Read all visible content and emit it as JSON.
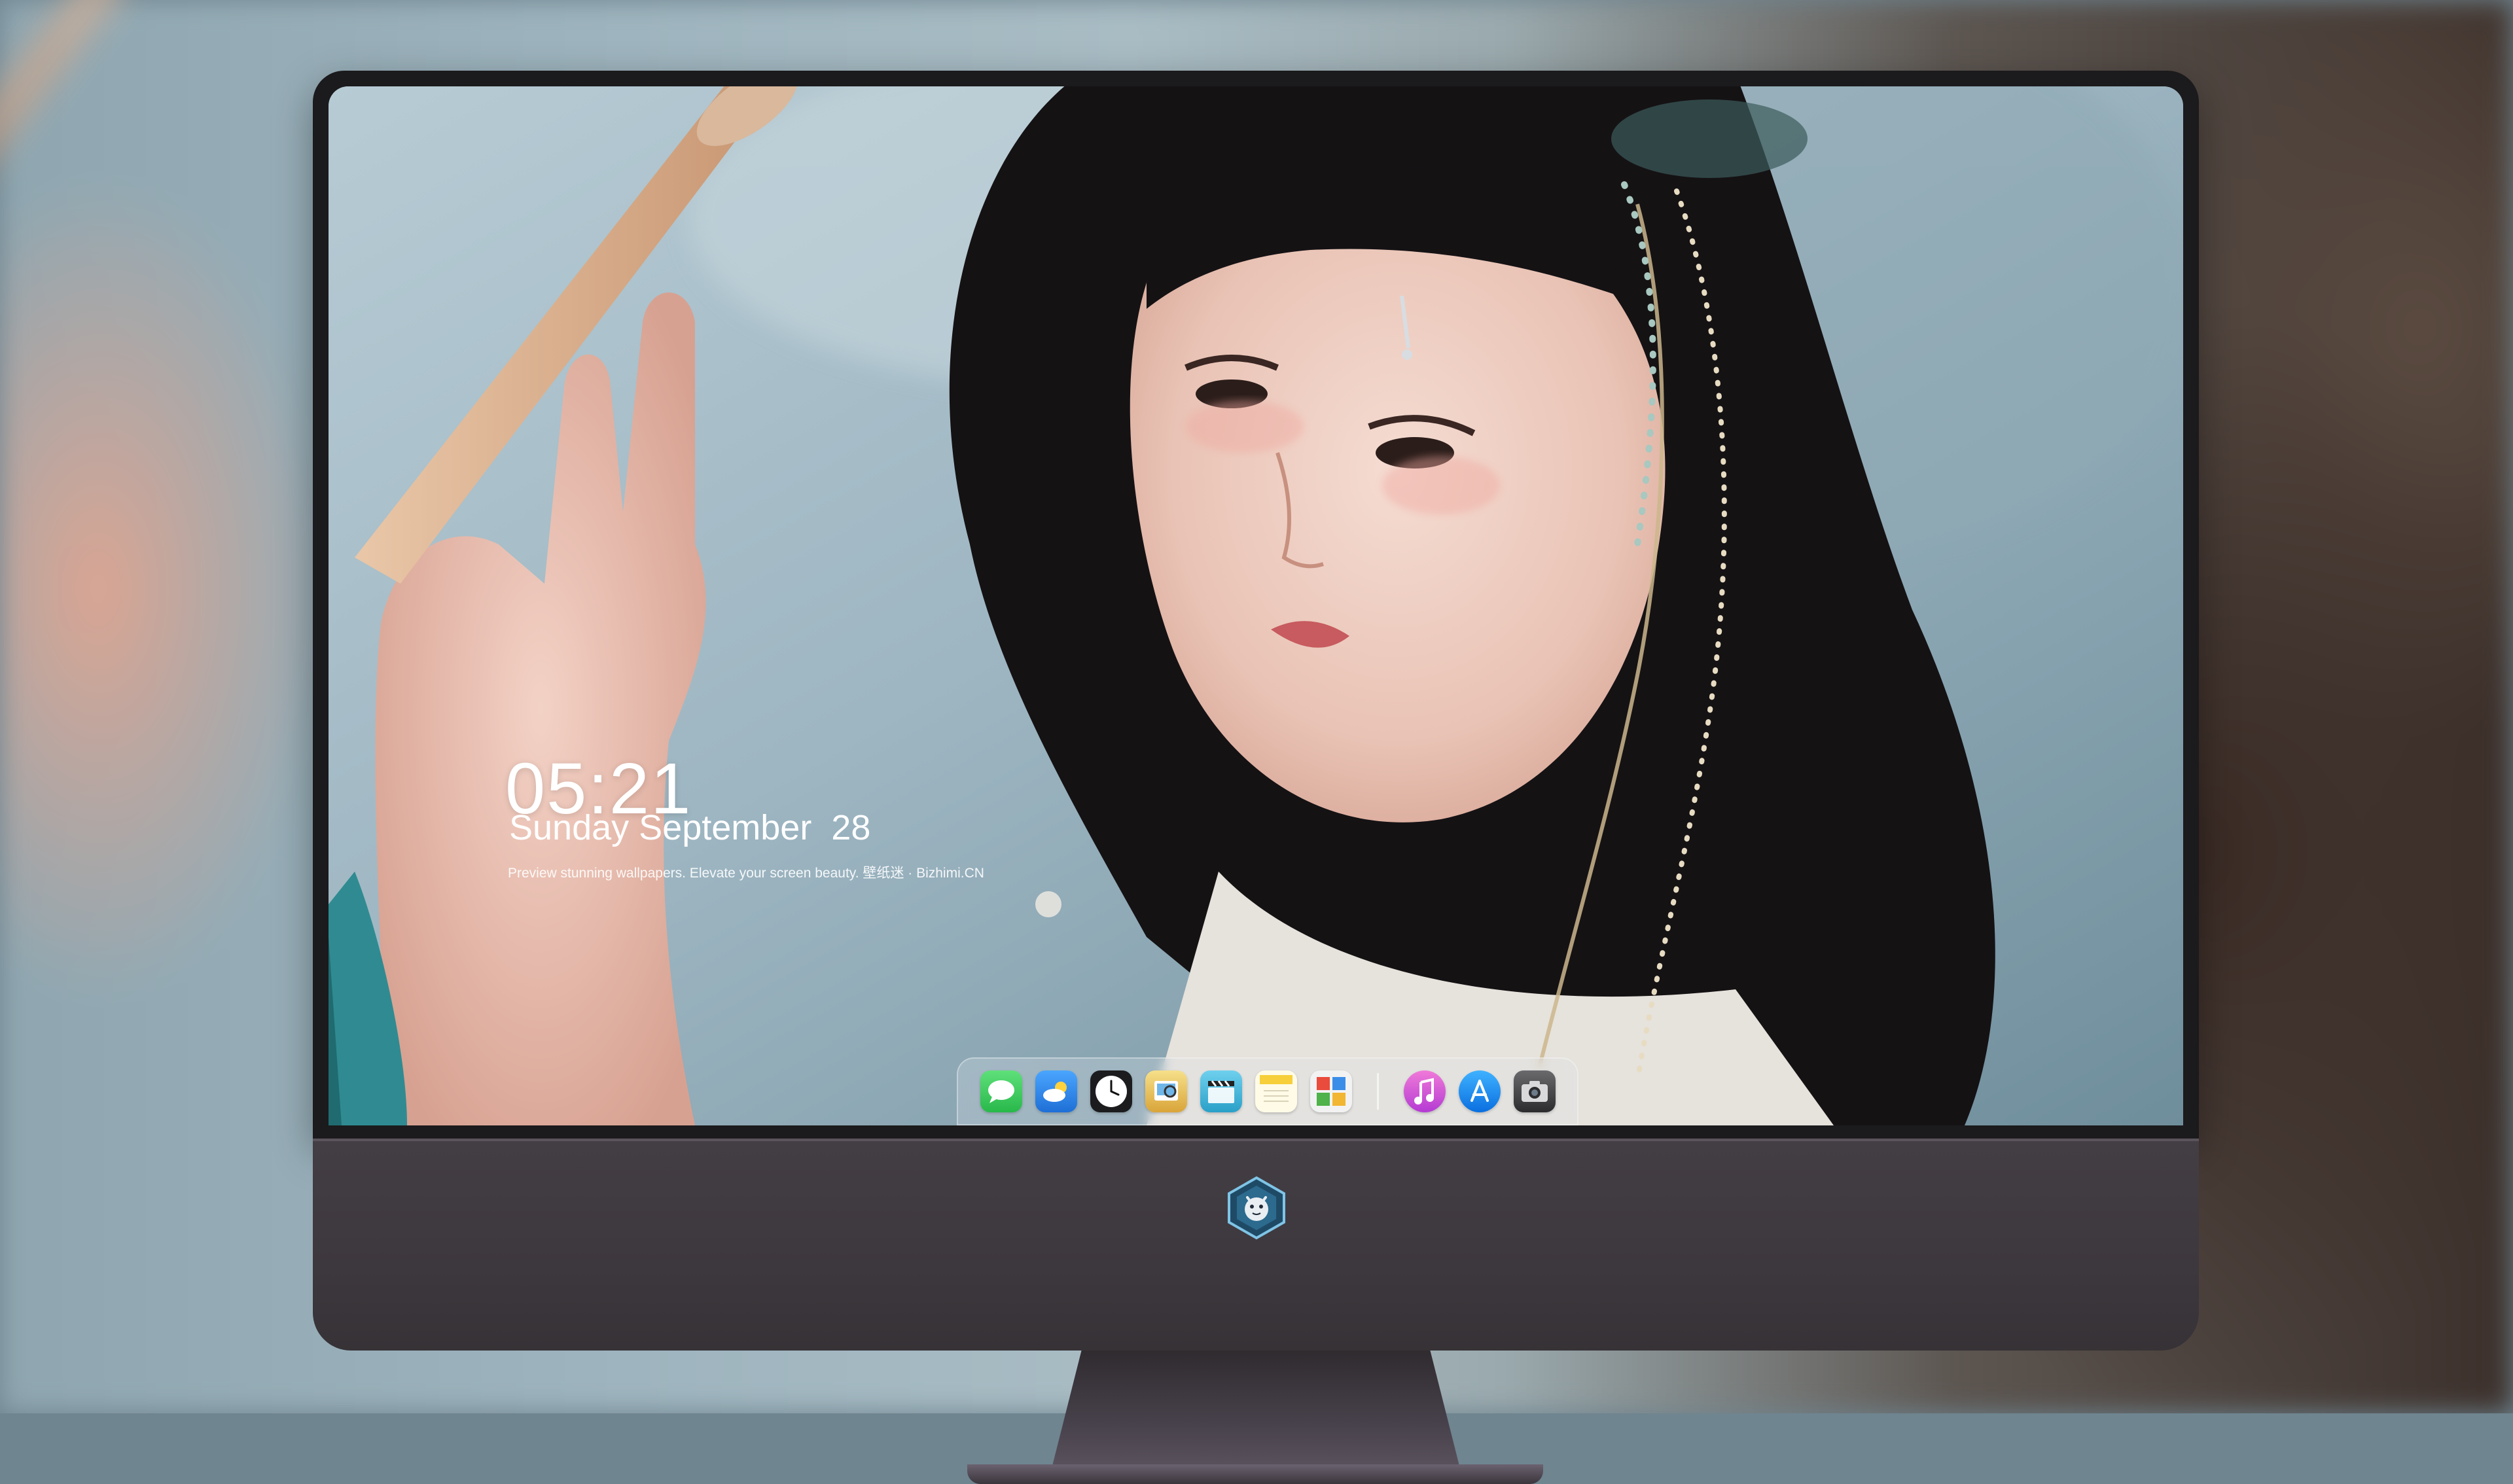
{
  "lockscreen": {
    "time": "05:21",
    "date": "Sunday September  28",
    "caption": "Preview stunning wallpapers. Elevate your screen beauty. 壁纸迷 · Bizhimi.CN"
  },
  "dock": {
    "apps": [
      {
        "icon": "messages-icon",
        "color": "#35c759"
      },
      {
        "icon": "weather-icon",
        "color": "#2f8ef0"
      },
      {
        "icon": "clock-icon",
        "color": "#1c1c1e"
      },
      {
        "icon": "preview-icon",
        "color": "#e9c44a"
      },
      {
        "icon": "video-clapper-icon",
        "color": "#4ab6d8"
      },
      {
        "icon": "notes-icon",
        "color": "#f6cf3a"
      },
      {
        "icon": "photo-booth-icon",
        "color": "#58a84a"
      },
      {
        "icon": "itunes-icon",
        "color": "#d34bd0"
      },
      {
        "icon": "app-store-icon",
        "color": "#1a8cf2"
      },
      {
        "icon": "camera-icon",
        "color": "#444446"
      }
    ]
  },
  "colors": {
    "bezel": "#1b1a1c",
    "chin": "#3f3a40",
    "wallpaper_sky": "#9db6c2"
  }
}
